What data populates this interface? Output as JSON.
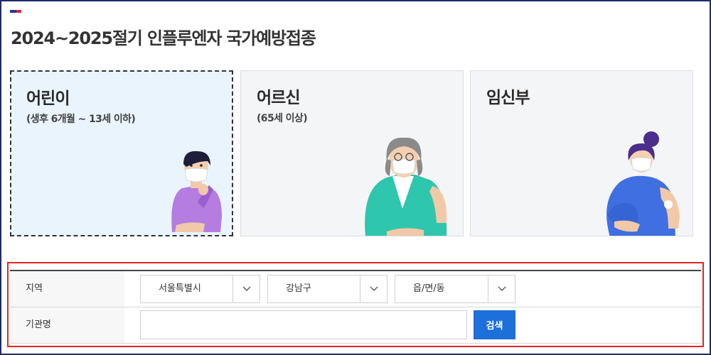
{
  "page": {
    "title": "2024~2025절기 인플루엔자 국가예방접종"
  },
  "cards": [
    {
      "name": "어린이",
      "sub": "(생후 6개월 ~ 13세 이하)",
      "selected": true
    },
    {
      "name": "어르신",
      "sub": "(65세 이상)",
      "selected": false
    },
    {
      "name": "임신부",
      "sub": "",
      "selected": false
    }
  ],
  "search": {
    "region_label": "지역",
    "region_values": [
      "서울특별시",
      "강남구",
      "읍/면/동"
    ],
    "org_label": "기관명",
    "org_value": "",
    "org_placeholder": "",
    "search_button": "검색"
  },
  "colors": {
    "frame": "#1f2a6b",
    "selected_card_bg": "#e9f4fd",
    "highlight_border": "#e02424",
    "button": "#1d6fd9"
  },
  "icons": [
    "chevron-down-icon",
    "korean-flag-icon"
  ]
}
